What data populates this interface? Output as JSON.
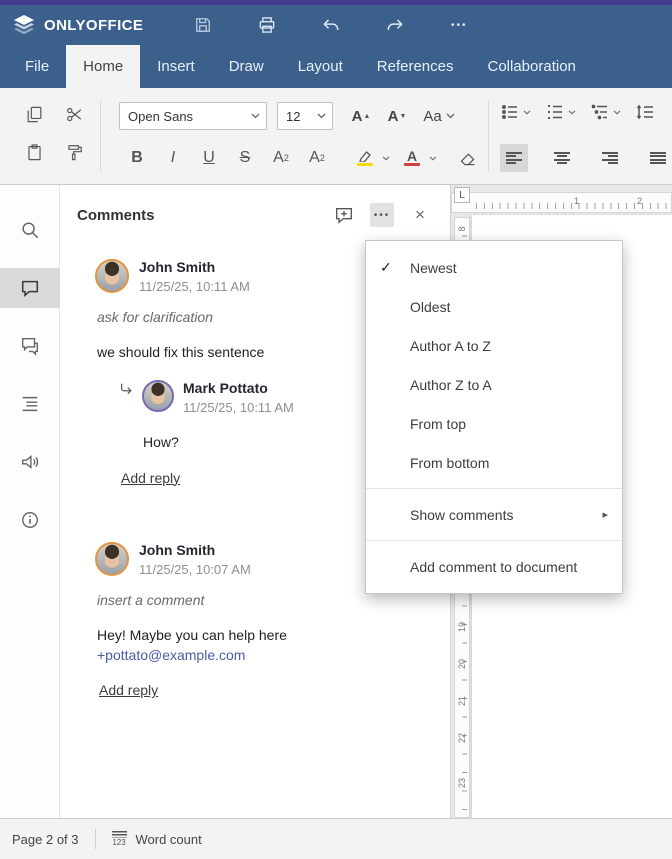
{
  "icons": {
    "menu_dots": "•••",
    "close": "×",
    "check": "✓",
    "submenu_arrow": "▸",
    "up_arrow": "▲",
    "down_arrow": "▼"
  },
  "titlebar": {
    "app_name": "ONLYOFFICE"
  },
  "tabs": {
    "items": [
      {
        "label": "File"
      },
      {
        "label": "Home",
        "active": true
      },
      {
        "label": "Insert"
      },
      {
        "label": "Draw"
      },
      {
        "label": "Layout"
      },
      {
        "label": "References"
      },
      {
        "label": "Collaboration"
      }
    ]
  },
  "toolbar": {
    "font_name": "Open Sans",
    "font_size": "12",
    "bold": "B",
    "italic": "I",
    "underline": "U",
    "strike": "S",
    "superscript_letter": "A",
    "superscript_mark": "2",
    "subscript_letter": "A",
    "subscript_mark": "2",
    "grow_font_letter": "A",
    "shrink_font_letter": "A",
    "change_case": "Aa",
    "font_color_letter": "A"
  },
  "comments_panel": {
    "title": "Comments",
    "comments": [
      {
        "author": "John Smith",
        "timestamp": "11/25/25, 10:11 AM",
        "quote": "ask for clarification",
        "body": "we should fix this sentence",
        "add_reply": "Add reply",
        "reply": {
          "author": "Mark Pottato",
          "timestamp": "11/25/25, 10:11 AM",
          "body": "How?"
        }
      },
      {
        "author": "John Smith",
        "timestamp": "11/25/25, 10:07 AM",
        "quote": "insert a comment",
        "body": "Hey! Maybe you can help here",
        "mention": "+pottato@example.com",
        "add_reply": "Add reply"
      }
    ]
  },
  "sort_menu": {
    "items": [
      {
        "label": "Newest",
        "checked": "✓"
      },
      {
        "label": "Oldest"
      },
      {
        "label": "Author A to Z"
      },
      {
        "label": "Author Z to A"
      },
      {
        "label": "From top"
      },
      {
        "label": "From bottom"
      }
    ],
    "show_comments": "Show comments",
    "add_comment_to_document": "Add comment to document"
  },
  "ruler": {
    "tab_selector": "L",
    "h_numbers": [
      "1",
      "2"
    ],
    "v_numbers": [
      "8",
      "19",
      "20",
      "21",
      "22",
      "23"
    ]
  },
  "statusbar": {
    "page_indicator": "Page 2 of 3",
    "word_count_icon_text": "123",
    "word_count": "Word count"
  },
  "colors": {
    "titlebar_blue": "#3c608c",
    "top_strip_purple": "#45398c",
    "toolbar_gray": "#f3f3f3",
    "highlight_yellow": "#f3d712",
    "font_color_red": "#d04040",
    "avatar_ring_orange": "#e2953f",
    "avatar_ring_purple": "#7b68b5",
    "mention_link_blue": "#4a5ca5"
  }
}
